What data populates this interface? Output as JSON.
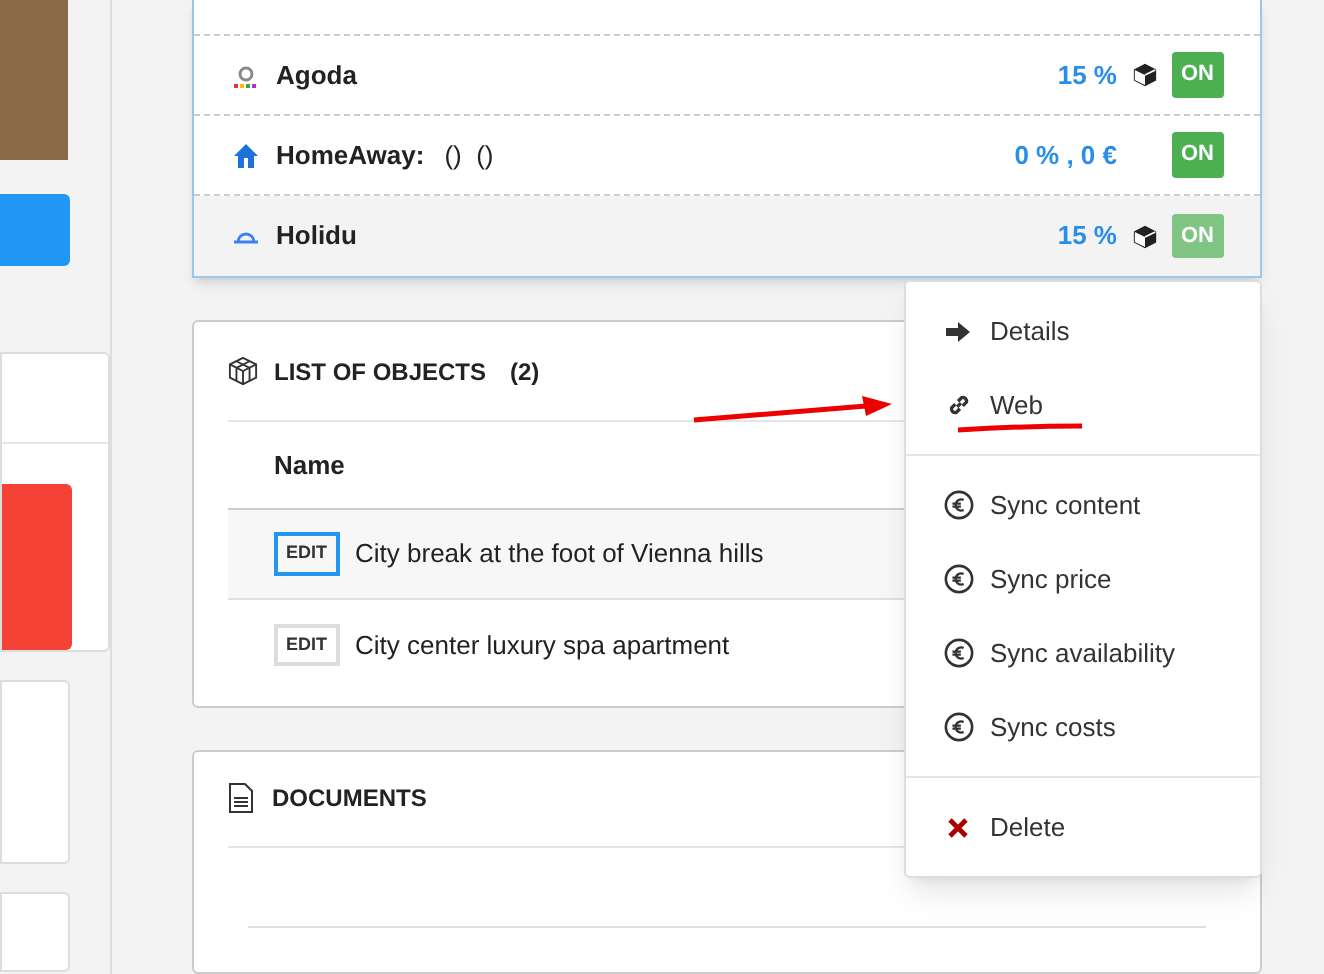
{
  "channels": [
    {
      "name": "Agoda",
      "kind": "agoda",
      "rate": "15 %",
      "box": true,
      "status": "ON",
      "dimmed": false,
      "highlighted": false
    },
    {
      "name": "HomeAway:",
      "kind": "homeaway",
      "extra": "()  ()",
      "rate": "0 % , 0 €",
      "box": false,
      "status": "ON",
      "dimmed": false,
      "highlighted": false
    },
    {
      "name": "Holidu",
      "kind": "holidu",
      "rate": "15 %",
      "box": true,
      "status": "ON",
      "dimmed": true,
      "highlighted": true
    }
  ],
  "objects": {
    "title": "LIST OF OBJECTS",
    "count": "(2)",
    "column": "Name",
    "rows": [
      {
        "button": "EDIT",
        "name": "City break at the foot of Vienna hills",
        "selected": true
      },
      {
        "button": "EDIT",
        "name": "City center luxury spa apartment",
        "selected": false
      }
    ]
  },
  "documents": {
    "title": "DOCUMENTS"
  },
  "menu": [
    [
      {
        "kind": "arrow",
        "label": "Details"
      },
      {
        "kind": "link",
        "label": "Web"
      }
    ],
    [
      {
        "kind": "euro",
        "label": "Sync content"
      },
      {
        "kind": "euro",
        "label": "Sync price"
      },
      {
        "kind": "euro",
        "label": "Sync availability"
      },
      {
        "kind": "euro",
        "label": "Sync costs"
      }
    ],
    [
      {
        "kind": "delete",
        "label": "Delete"
      }
    ]
  ]
}
